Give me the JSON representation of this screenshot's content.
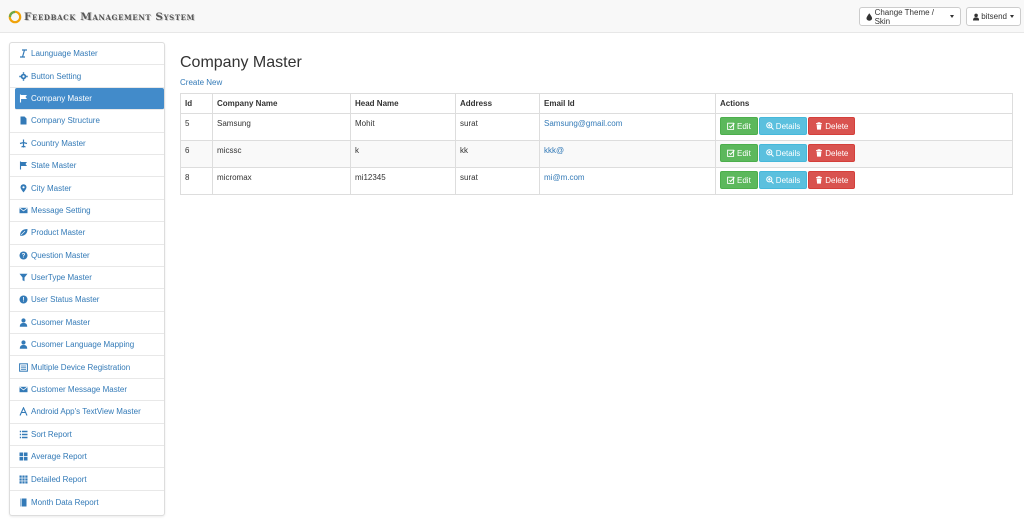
{
  "brand": {
    "title": "Feedback Management System"
  },
  "navbar": {
    "theme_label": "Change Theme / Skin",
    "user_label": "bitsend"
  },
  "sidebar": {
    "items": [
      {
        "label": "Launguage Master",
        "icon": "italic-icon"
      },
      {
        "label": "Button Setting",
        "icon": "cog-icon"
      },
      {
        "label": "Company Master",
        "icon": "flag-icon",
        "active": true
      },
      {
        "label": "Company Structure",
        "icon": "file-icon"
      },
      {
        "label": "Country Master",
        "icon": "plane-icon"
      },
      {
        "label": "State Master",
        "icon": "flag-icon"
      },
      {
        "label": "City Master",
        "icon": "map-marker-icon"
      },
      {
        "label": "Message Setting",
        "icon": "envelope-icon"
      },
      {
        "label": "Product Master",
        "icon": "leaf-icon"
      },
      {
        "label": "Question Master",
        "icon": "question-sign-icon"
      },
      {
        "label": "UserType Master",
        "icon": "filter-icon"
      },
      {
        "label": "User Status Master",
        "icon": "exclamation-sign-icon"
      },
      {
        "label": "Cusomer Master",
        "icon": "user-icon"
      },
      {
        "label": "Cusomer Language Mapping",
        "icon": "user-icon"
      },
      {
        "label": "Multiple Device Registration",
        "icon": "list-alt-icon"
      },
      {
        "label": "Customer Message Master",
        "icon": "envelope-icon"
      },
      {
        "label": "Android App's TextView Master",
        "icon": "font-icon"
      },
      {
        "label": "Sort Report",
        "icon": "list-icon"
      },
      {
        "label": "Average Report",
        "icon": "th-large-icon"
      },
      {
        "label": "Detailed Report",
        "icon": "th-icon"
      },
      {
        "label": "Month Data Report",
        "icon": "book-icon"
      }
    ]
  },
  "main": {
    "title": "Company Master",
    "create_label": "Create New",
    "columns": [
      "Id",
      "Company Name",
      "Head Name",
      "Address",
      "Email Id",
      "Actions"
    ],
    "rows": [
      {
        "id": "5",
        "company": "Samsung",
        "head": "Mohit",
        "address": "surat",
        "email": "Samsung@gmail.com"
      },
      {
        "id": "6",
        "company": "micssc",
        "head": "k",
        "address": "kk",
        "email": "kkk@"
      },
      {
        "id": "8",
        "company": "micromax",
        "head": "mi12345",
        "address": "surat",
        "email": "mi@m.com"
      }
    ],
    "actions": {
      "edit": "Edit",
      "details": "Details",
      "delete": "Delete"
    }
  },
  "colors": {
    "accent": "#428bca",
    "link": "#337ab7",
    "edit": "#5cb85c",
    "details": "#5bc0de",
    "delete": "#d9534f"
  }
}
